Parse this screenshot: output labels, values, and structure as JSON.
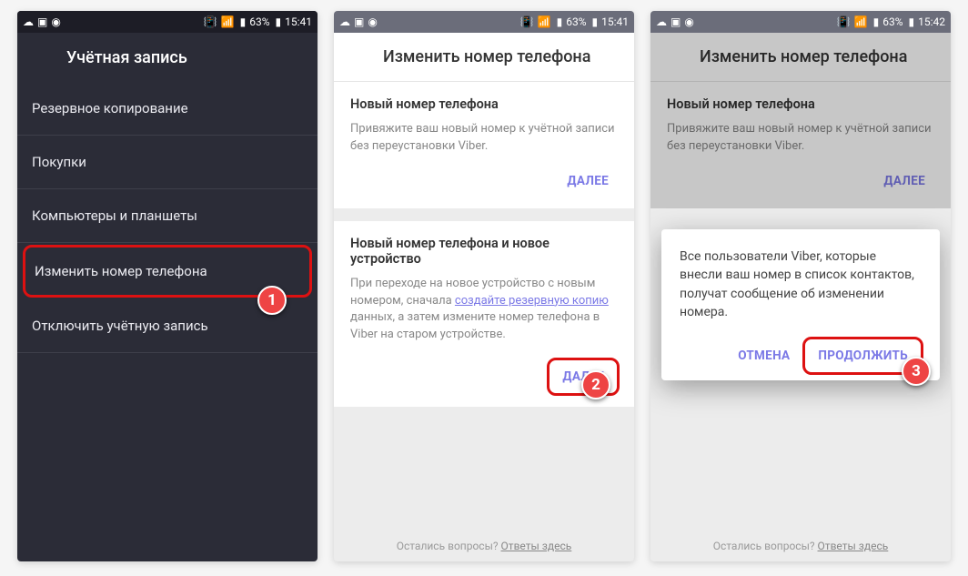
{
  "status": {
    "battery": "63%",
    "time1": "15:41",
    "time2": "15:41",
    "time3": "15:42"
  },
  "screen1": {
    "title": "Учётная запись",
    "items": {
      "backup": "Резервное копирование",
      "purchases": "Покупки",
      "devices": "Компьютеры и планшеты",
      "change": "Изменить номер телефона",
      "deactivate": "Отключить учётную запись"
    }
  },
  "screen2": {
    "title": "Изменить номер телефона",
    "section1": {
      "heading": "Новый номер телефона",
      "text": "Привяжите ваш новый номер к учётной записи без переустановки Viber.",
      "button": "ДАЛЕЕ"
    },
    "section2": {
      "heading": "Новый номер телефона и новое устройство",
      "text_before": "При переходе на новое устройство с новым номером, сначала ",
      "link": "создайте резервную копию",
      "text_after": " данных, а затем измените номер телефона в Viber на старом устройстве.",
      "button": "ДАЛЕЕ"
    },
    "footer": {
      "q": "Остались вопросы? ",
      "a": "Ответы здесь"
    }
  },
  "screen3": {
    "dialog": {
      "text": "Все пользователи Viber, которые внесли ваш номер в список контактов, получат сообщение об изменении номера.",
      "cancel": "ОТМЕНА",
      "ok": "ПРОДОЛЖИТЬ"
    }
  },
  "steps": {
    "s1": "1",
    "s2": "2",
    "s3": "3"
  }
}
